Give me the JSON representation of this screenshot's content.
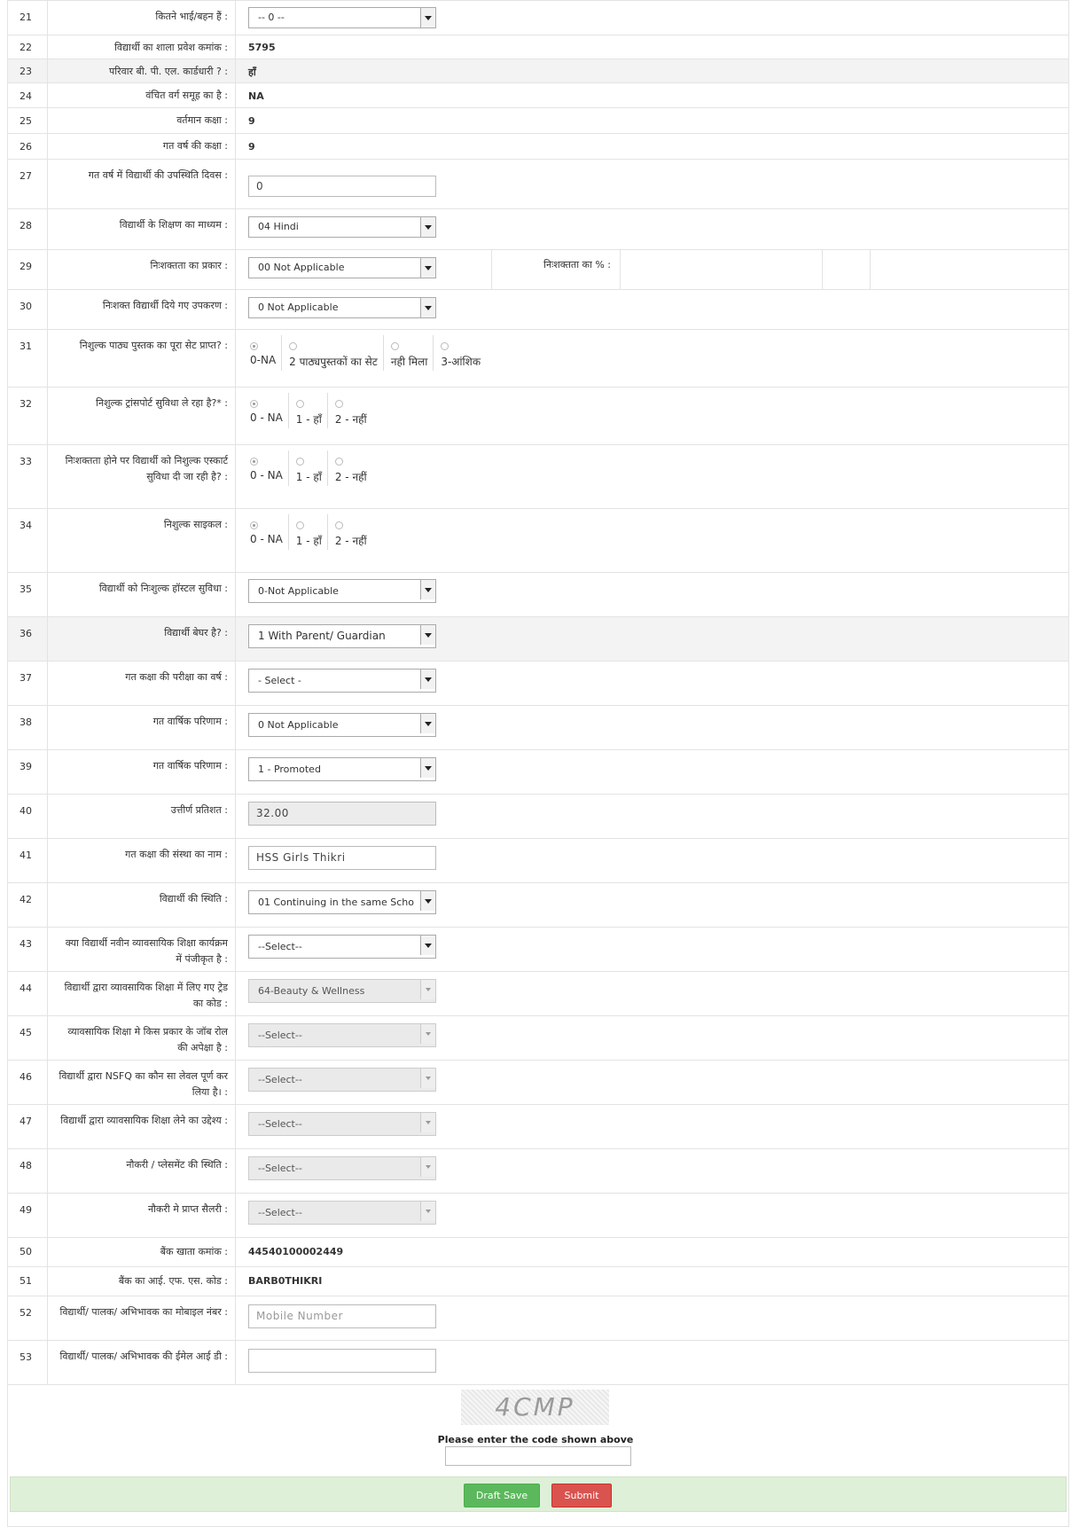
{
  "rows": {
    "r21": {
      "num": "21",
      "label": "कितने भाई/बहन हैं :",
      "value": "-- 0 --"
    },
    "r22": {
      "num": "22",
      "label": "विद्यार्थी का शाला प्रवेश कमांक :",
      "value": "5795"
    },
    "r23": {
      "num": "23",
      "label": "परिवार बी. पी. एल. कार्डधारी ? :",
      "value": "हाँ"
    },
    "r24": {
      "num": "24",
      "label": "वंचित वर्ग समूह का है :",
      "value": "NA"
    },
    "r25": {
      "num": "25",
      "label": "वर्तमान कक्षा :",
      "value": "9"
    },
    "r26": {
      "num": "26",
      "label": "गत वर्ष की कक्षा :",
      "value": "9"
    },
    "r27": {
      "num": "27",
      "label": "गत वर्ष में विद्यार्थी की उपस्थिति दिवस :",
      "value": "0"
    },
    "r28": {
      "num": "28",
      "label": "विद्यार्थी के शिक्षण का माध्यम :",
      "value": "04 Hindi"
    },
    "r29": {
      "num": "29",
      "label": "निःशक्तता का प्रकार :",
      "value": "00 Not Applicable",
      "label2": "निःशक्तता का % :"
    },
    "r30": {
      "num": "30",
      "label": "निःशक्त विद्यार्थी दिये गए उपकरण :",
      "value": "0 Not Applicable"
    },
    "r31": {
      "num": "31",
      "label": "निशुल्क पाठ्य पुस्तक का पूरा सेट प्राप्त? :",
      "options": [
        "0-NA",
        "2 पाठ्यपुस्तकों का सेट",
        "नही मिला",
        "3-आंशिक"
      ]
    },
    "r32": {
      "num": "32",
      "label": "निशुल्क ट्रांसपोर्ट सुविधा ले रहा है?* :",
      "options": [
        "0 - NA",
        "1 - हाँ",
        "2 - नहीं"
      ]
    },
    "r33": {
      "num": "33",
      "label": "निःशक्तता होने पर विद्यार्थी को निशुल्क एस्कार्ट सुविधा दी जा रही है? :",
      "options": [
        "0 - NA",
        "1 - हाँ",
        "2 - नहीं"
      ]
    },
    "r34": {
      "num": "34",
      "label": "निशुल्क साइकल :",
      "options": [
        "0 - NA",
        "1 - हाँ",
        "2 - नहीं"
      ]
    },
    "r35": {
      "num": "35",
      "label": "विद्यार्थी को निःशुल्क हॉस्टल सुविधा :",
      "value": "0-Not Applicable"
    },
    "r36": {
      "num": "36",
      "label": "विद्यार्थी बेघर है? :",
      "value": "1 With Parent/ Guardian"
    },
    "r37": {
      "num": "37",
      "label": "गत कक्षा की परीक्षा का वर्ष :",
      "value": "- Select -"
    },
    "r38": {
      "num": "38",
      "label": "गत वार्षिक परिणाम :",
      "value": "0 Not Applicable"
    },
    "r39": {
      "num": "39",
      "label": "गत वार्षिक परिणाम :",
      "value": "1 - Promoted"
    },
    "r40": {
      "num": "40",
      "label": "उत्तीर्ण प्रतिशत :",
      "value": "32.00"
    },
    "r41": {
      "num": "41",
      "label": "गत कक्षा की संस्था का नाम :",
      "value": "HSS Girls Thikri"
    },
    "r42": {
      "num": "42",
      "label": "विद्यार्थी की स्थिति :",
      "value": "01 Continuing in the same Scho"
    },
    "r43": {
      "num": "43",
      "label": "क्या विद्यार्थी नवीन व्यावसायिक शिक्षा कार्यक्रम में पंजीकृत है :",
      "value": "--Select--"
    },
    "r44": {
      "num": "44",
      "label": "विद्यार्थी द्वारा व्यावसायिक शिक्षा में लिए गए ट्रेड का कोड :",
      "value": "64-Beauty & Wellness"
    },
    "r45": {
      "num": "45",
      "label": "व्यावसायिक शिक्षा मे किस प्रकार के जॉब रोल की अपेक्षा है :",
      "value": "--Select--"
    },
    "r46": {
      "num": "46",
      "label": "विद्यार्थी द्वारा NSFQ का कौन सा लेवल पूर्ण कर लिया है। :",
      "value": "--Select--"
    },
    "r47": {
      "num": "47",
      "label": "विद्यार्थी द्वारा व्यावसायिक शिक्षा लेने का उद्देश्य :",
      "value": "--Select--"
    },
    "r48": {
      "num": "48",
      "label": "नौकरी / प्लेसमेंट की स्थिति :",
      "value": "--Select--"
    },
    "r49": {
      "num": "49",
      "label": "नौकरी मे प्राप्त सैलरी :",
      "value": "--Select--"
    },
    "r50": {
      "num": "50",
      "label": "बैंक खाता कमांक :",
      "value": "44540100002449"
    },
    "r51": {
      "num": "51",
      "label": "बैंक का आई. एफ. एस. कोड :",
      "value": "BARB0THIKRI"
    },
    "r52": {
      "num": "52",
      "label": "विद्यार्थी/ पालक/ अभिभावक का मोबाइल नंबर :",
      "placeholder": "Mobile Number"
    },
    "r53": {
      "num": "53",
      "label": "विद्यार्थी/ पालक/ अभिभावक की ईमेल आई डी :"
    }
  },
  "captcha": {
    "text": "4CMP",
    "label": "Please enter the code shown above"
  },
  "buttons": {
    "draft": "Draft Save",
    "submit": "Submit"
  }
}
